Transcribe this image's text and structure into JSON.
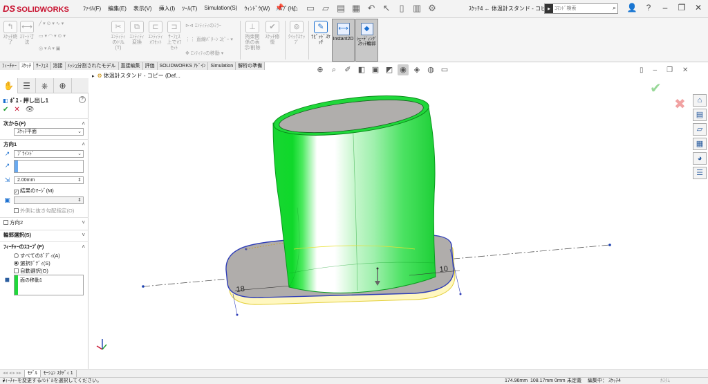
{
  "app": {
    "logo_text": "SOLIDWORKS"
  },
  "menu": [
    "ﾌｧｲﾙ(F)",
    "編集(E)",
    "表示(V)",
    "挿入(I)",
    "ﾂｰﾙ(T)",
    "Simulation(S)",
    "ｳｨﾝﾄﾞｳ(W)",
    "ﾍﾙﾌﾟ(H)"
  ],
  "document_title": "ｽｹｯﾁ4 ← 体温計スタンド - コピー.SL...",
  "search": {
    "placeholder": "ｺﾏﾝﾄﾞ検索"
  },
  "ribbon": {
    "buttons": [
      "ｽｹｯﾁ終了",
      "ｽﾏｰﾄ寸法",
      "ｴﾝﾃｨﾃｨのﾄﾘﾑ(T)",
      "ｴﾝﾃｨﾃｨ変換",
      "ｴﾝﾃｨﾃｨｵﾌｾｯﾄ",
      "ｻｰﾌｪｽ上でｵﾌｾｯﾄ",
      "ｴﾝﾃｨﾃｨのﾐﾗｰ",
      "直線ﾊﾟﾀｰﾝ ｺﾋﾟｰ",
      "ｴﾝﾃｨﾃｨの移動",
      "拘束関係の表示/削除",
      "ｽｹｯﾁ修復",
      "ｸｲｯｸｽﾅｯﾌﾟ",
      "ﾗﾋﾟｯﾄﾞｽｹｯﾁ"
    ],
    "instant2d": "Instant2D",
    "shaded_sketch": "ｼｪｰﾃﾞｨﾝｸﾞ ｽｹｯﾁ輪郭"
  },
  "command_tabs": [
    "ﾌｨｰﾁｬｰ",
    "ｽｹｯﾁ",
    "ｻｰﾌｪｽ",
    "溶接",
    "ﾒｯｼｭ分割されたモデル",
    "直接編集",
    "評価",
    "SOLIDWORKS ｱﾄﾞｲﾝ",
    "Simulation",
    "解析の準備"
  ],
  "feature_tree": {
    "root": "体温計スタンド - コピー (Def..."
  },
  "property_manager": {
    "title": "ﾎﾞｽ - 押し出し1",
    "from_section": "次から(F)",
    "from_value": "ｽｹｯﾁ平面",
    "direction1_section": "方向1",
    "end_condition": "ﾌﾞﾗｲﾝﾄﾞ",
    "depth": "2.00mm",
    "merge_result": "結果のﾏｰｼﾞ(M)",
    "draft_outward": "外側に抜き勾配指定(O)",
    "direction2_section": "方向2",
    "contour_section": "輪郭選択(S)",
    "scope_section": "ﾌｨｰﾁｬｰのｽｺｰﾌﾟ(F)",
    "scope_all": "すべてのﾎﾞﾃﾞｨ(A)",
    "scope_selected": "選択ﾎﾞﾃﾞｨ(S)",
    "scope_auto": "自動選択(O)",
    "scope_item": "面の移動1"
  },
  "dimensions": {
    "d1": "18",
    "d2": "10"
  },
  "bottom_tabs": [
    "ﾓﾃﾞﾙ",
    "ﾓｰｼｮﾝ ｽﾀﾃﾞｨ 1"
  ],
  "status_bar": {
    "hint": "ﾌｨｰﾁｬｰを変更するﾊﾝﾄﾞﾙを選択してください。",
    "x": "174.96mm",
    "y": "108.17mm",
    "z": "0mm",
    "state": "未定義",
    "editing": "編集中： ｽｹｯﾁ4",
    "units": "ｶｽﾀﾑ"
  },
  "colors": {
    "accent": "#1a6fd0",
    "logo": "#c8102e",
    "body_green": "#22e03a",
    "ok_green": "#1c9c2c"
  }
}
